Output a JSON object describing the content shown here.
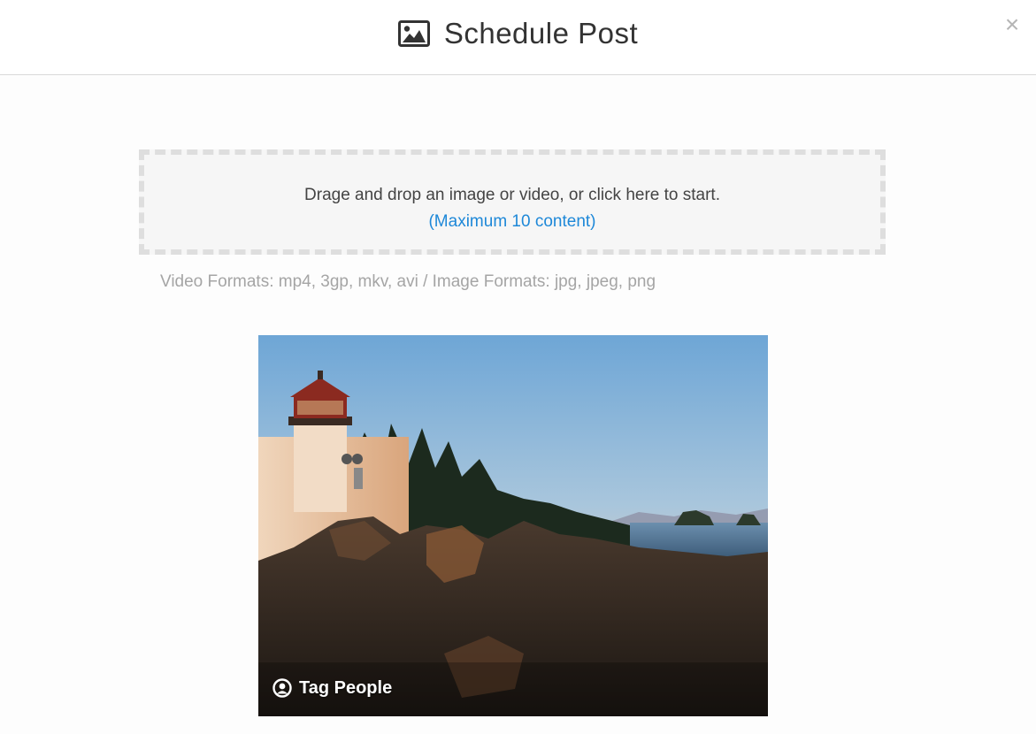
{
  "header": {
    "title": "Schedule Post",
    "title_icon": "image-icon",
    "close_symbol": "×"
  },
  "dropzone": {
    "main_text": "Drage and drop an image or video, or click here to start.",
    "sub_text": "(Maximum 10 content)"
  },
  "formats_text": "Video Formats: mp4, 3gp, mkv, avi / Image Formats: jpg, jpeg, png",
  "media": {
    "tag_label": "Tag People",
    "tag_icon": "user-circle-icon"
  },
  "colors": {
    "accent": "#1e88d8",
    "muted_text": "#a5a5a5",
    "dropzone_border": "#dedede"
  }
}
